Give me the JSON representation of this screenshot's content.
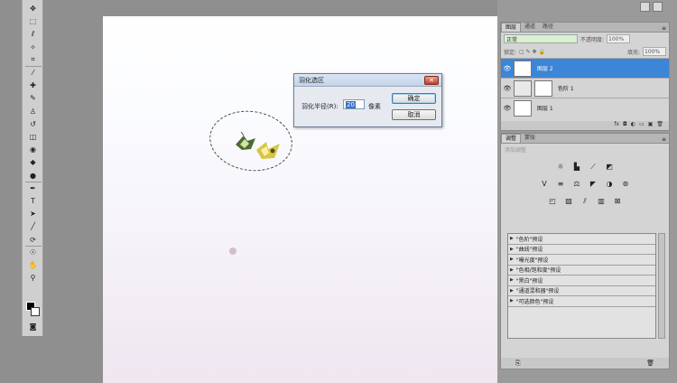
{
  "toolbar": {
    "tools": [
      {
        "name": "move-tool",
        "glyph": "✥"
      },
      {
        "name": "marquee-tool",
        "glyph": "⬚"
      },
      {
        "name": "lasso-tool",
        "glyph": "ℓ"
      },
      {
        "name": "magic-wand-tool",
        "glyph": "✧"
      },
      {
        "name": "crop-tool",
        "glyph": "⌗"
      },
      {
        "name": "eyedropper-tool",
        "glyph": "⁄"
      },
      {
        "name": "healing-brush-tool",
        "glyph": "✚"
      },
      {
        "name": "brush-tool",
        "glyph": "✎"
      },
      {
        "name": "clone-stamp-tool",
        "glyph": "♙"
      },
      {
        "name": "history-brush-tool",
        "glyph": "↺"
      },
      {
        "name": "eraser-tool",
        "glyph": "◫"
      },
      {
        "name": "paint-bucket-tool",
        "glyph": "◉"
      },
      {
        "name": "blur-tool",
        "glyph": "◆"
      },
      {
        "name": "dodge-tool",
        "glyph": "●"
      },
      {
        "name": "pen-tool",
        "glyph": "✒"
      },
      {
        "name": "type-tool",
        "glyph": "T"
      },
      {
        "name": "path-select-tool",
        "glyph": "➤"
      },
      {
        "name": "line-tool",
        "glyph": "╱"
      },
      {
        "name": "3d-rotate-tool",
        "glyph": "⟳"
      },
      {
        "name": "3d-orbit-tool",
        "glyph": "☉"
      },
      {
        "name": "hand-tool",
        "glyph": "✋"
      },
      {
        "name": "zoom-tool",
        "glyph": "⚲"
      }
    ]
  },
  "dialog": {
    "title": "羽化选区",
    "radius_label": "羽化半径(R):",
    "radius_value": "20",
    "unit": "像素",
    "ok_label": "确定",
    "cancel_label": "取消",
    "close_glyph": "✕"
  },
  "layers_panel": {
    "tabs": [
      "图层",
      "通道",
      "路径"
    ],
    "blend_mode": "正常",
    "opacity_label": "不透明度:",
    "opacity_value": "100%",
    "lock_label": "锁定:",
    "fill_label": "填充:",
    "fill_value": "100%",
    "layers": [
      {
        "name": "图层 2",
        "selected": true
      },
      {
        "name": "色阶 1",
        "selected": false
      },
      {
        "name": "图层 1",
        "selected": false
      }
    ],
    "footer_icons": [
      "fx",
      "◘",
      "◐",
      "▭",
      "▣",
      "🗑"
    ]
  },
  "adjust_panel": {
    "tabs": [
      "调整",
      "蒙版"
    ],
    "hint": "添加调整",
    "icon_rows": [
      [
        "☼",
        "▙",
        "⟋",
        "◩"
      ],
      [
        "V",
        "≡",
        "⚖",
        "◤",
        "◑",
        "⊛"
      ],
      [
        "◰",
        "▨",
        "⫽",
        "▥",
        "⊠"
      ]
    ],
    "presets": [
      "\"色阶\"预设",
      "\"曲线\"预设",
      "\"曝光度\"预设",
      "\"色相/饱和度\"预设",
      "\"黑白\"预设",
      "\"通道混和器\"预设",
      "\"可选颜色\"预设"
    ]
  },
  "colors": {
    "accent": "#3d85d6",
    "canvas": "#ffffff",
    "workspace": "#8f8f8f"
  }
}
